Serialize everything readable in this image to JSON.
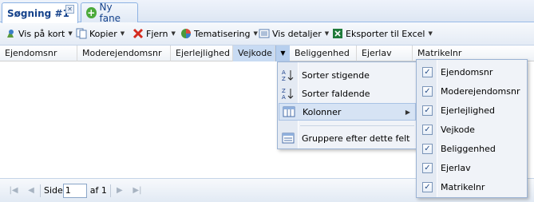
{
  "tabs": {
    "active_label": "Søgning #1",
    "close_glyph": "✕",
    "new_tab_label": "Ny fane"
  },
  "toolbar": {
    "show_on_map": "Vis på kort",
    "copy": "Kopier",
    "remove": "Fjern",
    "thematize": "Tematisering",
    "show_details": "Vis detaljer",
    "export_excel": "Eksporter til Excel"
  },
  "columns": [
    "Ejendomsnr",
    "Moderejendomsnr",
    "Ejerlejlighed",
    "Vejkode",
    "Beliggenhed",
    "Ejerlav",
    "Matrikelnr"
  ],
  "column_menu": {
    "sort_asc": "Sorter stigende",
    "sort_desc": "Sorter faldende",
    "columns": "Kolonner",
    "group_by": "Gruppere efter dette felt"
  },
  "column_toggles": [
    {
      "label": "Ejendomsnr",
      "checked": true
    },
    {
      "label": "Moderejendomsnr",
      "checked": true
    },
    {
      "label": "Ejerlejlighed",
      "checked": true
    },
    {
      "label": "Vejkode",
      "checked": true
    },
    {
      "label": "Beliggenhed",
      "checked": true
    },
    {
      "label": "Ejerlav",
      "checked": true
    },
    {
      "label": "Matrikelnr",
      "checked": true
    }
  ],
  "pager": {
    "page_label": "Side",
    "page_value": "1",
    "of_label": "af 1"
  },
  "colors": {
    "accent": "#15428b",
    "border": "#99bbe8",
    "menu_highlight": "#d6e3f4"
  }
}
